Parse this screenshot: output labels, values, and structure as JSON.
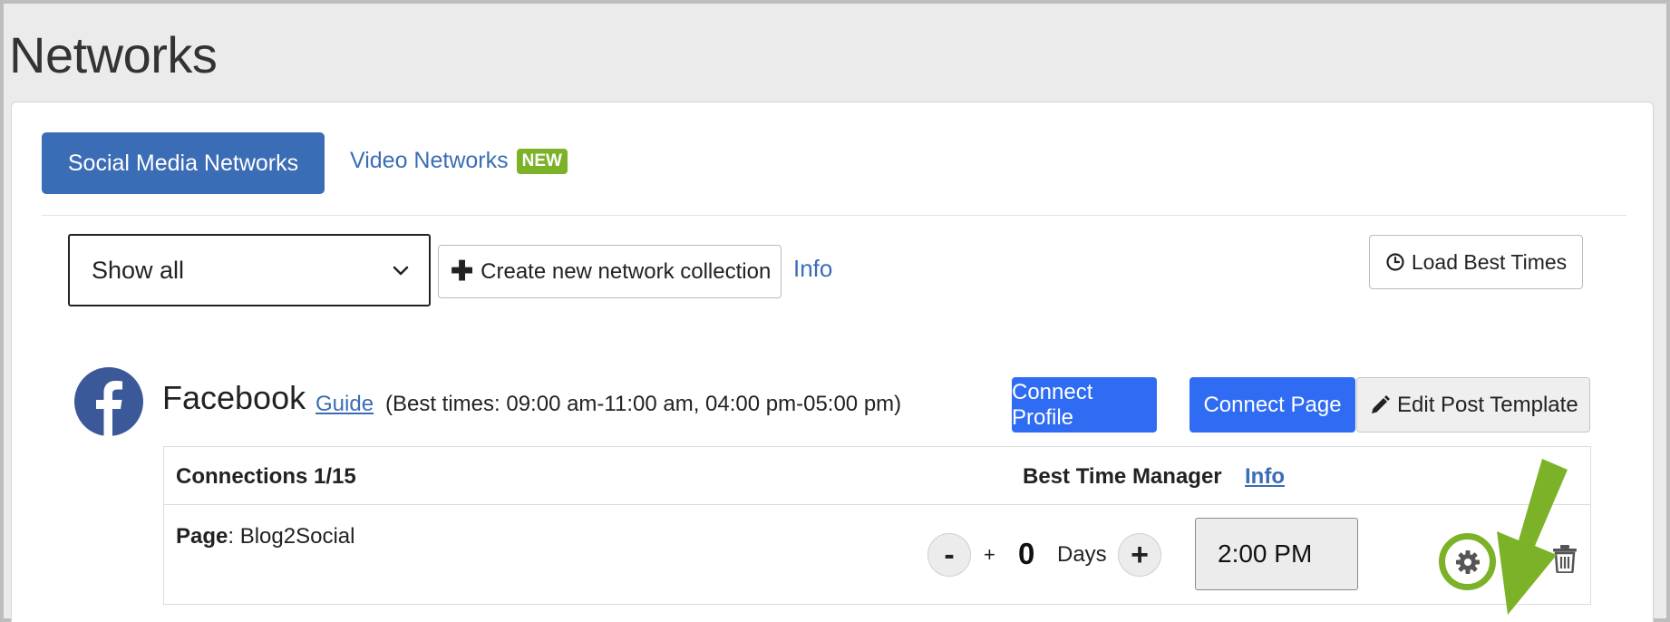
{
  "page": {
    "title": "Networks"
  },
  "tabs": {
    "social": "Social Media Networks",
    "video": "Video Networks",
    "video_badge": "NEW"
  },
  "filter": {
    "selected": "Show all"
  },
  "toolbar": {
    "create_collection": "Create new network collection",
    "info": "Info",
    "load_best_times": "Load Best Times"
  },
  "network": {
    "name": "Facebook",
    "guide": "Guide",
    "best_times": "(Best times: 09:00 am-11:00 am, 04:00 pm-05:00 pm)",
    "connect_profile": "Connect Profile",
    "connect_page": "Connect Page",
    "edit_template": "Edit Post Template"
  },
  "connections": {
    "title": "Connections 1/15",
    "best_time_manager": "Best Time Manager",
    "info": "Info",
    "row": {
      "type_label": "Page",
      "name": ": Blog2Social",
      "minus": "-",
      "small_plus": "+",
      "days_value": "0",
      "days_label": "Days",
      "plus": "+",
      "time": "2:00 PM"
    }
  },
  "colors": {
    "accent_blue": "#3a6db5",
    "button_blue": "#2f6cf3",
    "new_badge": "#7cb228",
    "annotation_green": "#7cb228",
    "facebook_blue": "#3b5998"
  },
  "icons": [
    "chevron-down-icon",
    "plus-icon",
    "clock-icon",
    "facebook-icon",
    "pencil-icon",
    "gear-icon",
    "sync-icon",
    "trash-icon",
    "annotation-arrow"
  ]
}
